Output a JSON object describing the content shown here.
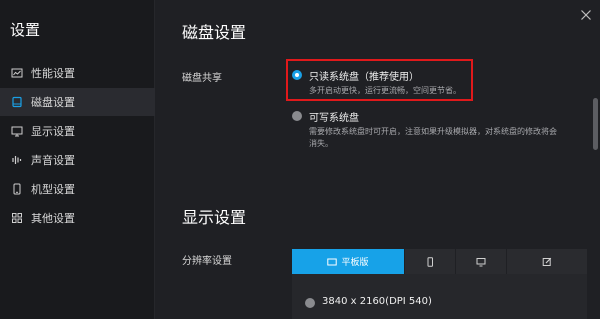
{
  "sidebar": {
    "title": "设置",
    "items": [
      {
        "label": "性能设置",
        "icon": "performance-chart-icon"
      },
      {
        "label": "磁盘设置",
        "icon": "disk-icon"
      },
      {
        "label": "显示设置",
        "icon": "monitor-icon"
      },
      {
        "label": "声音设置",
        "icon": "audio-wave-icon"
      },
      {
        "label": "机型设置",
        "icon": "phone-icon"
      },
      {
        "label": "其他设置",
        "icon": "grid-icon"
      }
    ],
    "active_index": 1
  },
  "disk": {
    "title": "磁盘设置",
    "share_label": "磁盘共享",
    "options": [
      {
        "label": "只读系统盘（推荐使用）",
        "desc": "多开启动更快，运行更流畅，空间更节省。",
        "checked": true
      },
      {
        "label": "可写系统盘",
        "desc_line1": "需要修改系统盘时可开启，注意如果升级模拟器，对系统盘的修改将会",
        "desc_line2": "消失。",
        "checked": false
      }
    ]
  },
  "display": {
    "title": "显示设置",
    "resolution_label": "分辨率设置",
    "tabs": [
      {
        "label": "平板版",
        "icon": "tablet-landscape-icon",
        "active": true
      },
      {
        "label": "",
        "icon": "phone-portrait-icon",
        "active": false
      },
      {
        "label": "",
        "icon": "monitor-icon",
        "active": false
      },
      {
        "label": "",
        "icon": "edit-icon",
        "active": false
      }
    ],
    "resolutions": [
      {
        "label": "3840 x 2160(DPI 540)",
        "checked": false
      }
    ]
  },
  "colors": {
    "accent": "#17a2e8",
    "highlight": "#e0191b",
    "background": "#1f2024",
    "sidebar": "#191a1d"
  }
}
